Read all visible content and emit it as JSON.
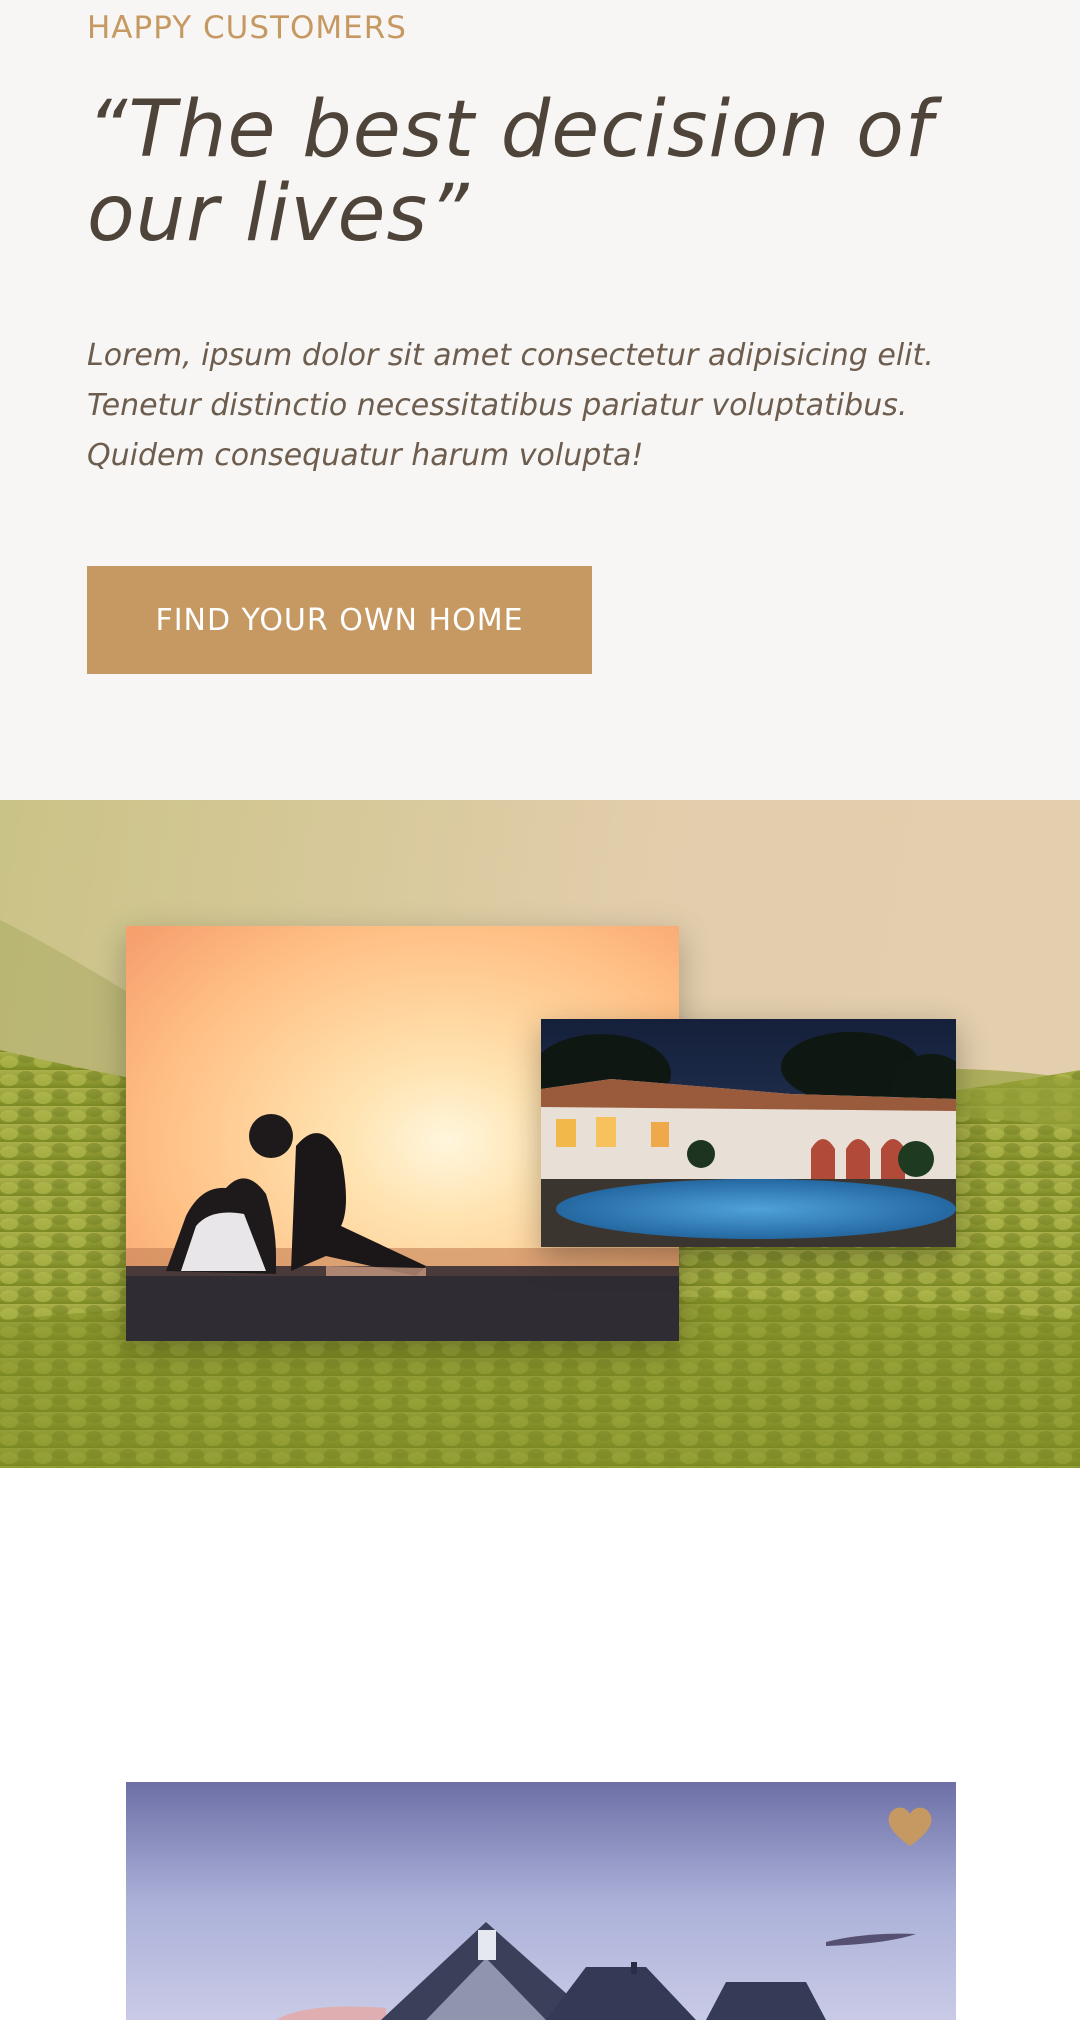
{
  "testimonial": {
    "subtitle": "HAPPY CUSTOMERS",
    "quote": "“The best decision of our lives”",
    "body": "Lorem, ipsum dolor sit amet consectetur adipisicing elit. Tenetur distinctio necessitatibus pariatur voluptatibus. Quidem consequatur harum volupta!",
    "cta_label": "FIND YOUR OWN HOME"
  },
  "colors": {
    "background": "#f8f6f4",
    "primary": "#c69963",
    "heading": "#4f4439",
    "body_text": "#6d5d4f"
  },
  "gallery": {
    "images": [
      "couple-sunset-photo",
      "villa-pool-photo"
    ],
    "background": "green-hills-photo"
  },
  "homes": {
    "card_image": "house-dusk-photo",
    "favorite_icon": "heart-icon"
  }
}
